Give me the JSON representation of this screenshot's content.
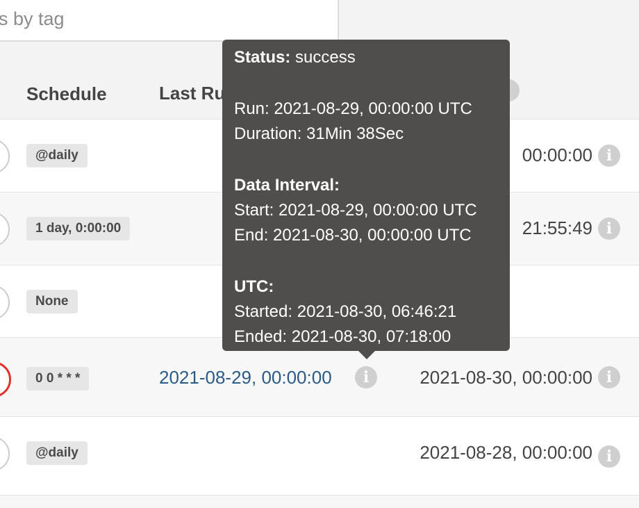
{
  "search": {
    "visible_text": "s by tag"
  },
  "table": {
    "headers": {
      "schedule": "Schedule",
      "last_run": "Last Ru"
    },
    "rows": [
      {
        "schedule": "@daily",
        "next_run": "00:00:00"
      },
      {
        "schedule": "1 day, 0:00:00",
        "next_run": "21:55:49"
      },
      {
        "schedule": "None",
        "next_run": ""
      },
      {
        "schedule": "0 0 * * *",
        "last_run": "2021-08-29, 00:00:00",
        "next_run": "2021-08-30, 00:00:00"
      },
      {
        "schedule": "@daily",
        "next_run": "2021-08-28, 00:00:00"
      }
    ]
  },
  "tooltip": {
    "status_label": "Status:",
    "status_value": "success",
    "run": "Run: 2021-08-29, 00:00:00 UTC",
    "duration": "Duration: 31Min 38Sec",
    "interval_heading": "Data Interval:",
    "interval_start": "Start: 2021-08-29, 00:00:00 UTC",
    "interval_end": "End: 2021-08-30, 00:00:00 UTC",
    "utc_heading": "UTC:",
    "started": "Started: 2021-08-30, 06:46:21",
    "ended": "Ended: 2021-08-30, 07:18:00"
  },
  "icons": {
    "info": "info-icon"
  },
  "colors": {
    "link": "#2c5b87",
    "tooltip_bg": "#4f4e4c",
    "failed_ring": "#e0312c"
  }
}
